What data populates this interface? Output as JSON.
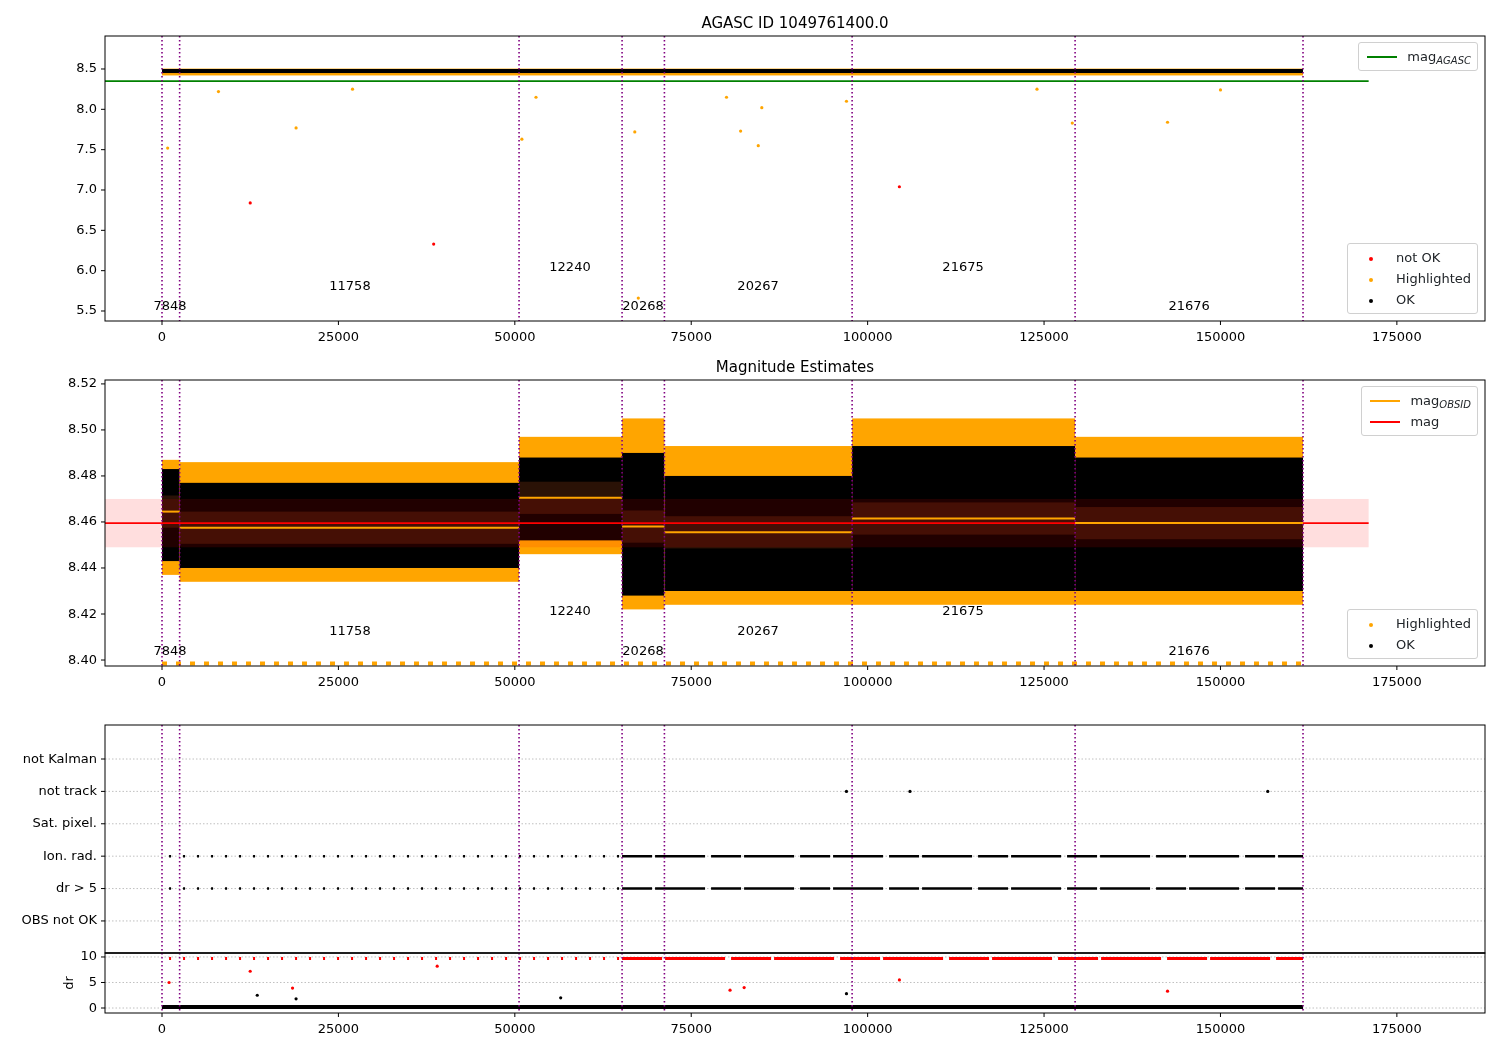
{
  "figure": {
    "panels": [
      {
        "kind": "magnitude",
        "title": "AGASC ID 1049761400.0",
        "xtick_labels": [
          "0",
          "25000",
          "50000",
          "75000",
          "100000",
          "125000",
          "150000",
          "175000"
        ],
        "ytick_labels": [
          "8.5",
          "8.0",
          "7.5",
          "7.0",
          "6.5",
          "6.0",
          "5.5"
        ],
        "obsid_labels": [
          "7848",
          "11758",
          "12240",
          "20268",
          "20267",
          "21675",
          "21676"
        ],
        "legends": [
          {
            "entries": [
              {
                "label": "mag$_{AGASC}$",
                "kind": "line",
                "color": "#008000"
              }
            ]
          },
          {
            "entries": [
              {
                "label": "not OK",
                "kind": "dot",
                "color": "#ff0000"
              },
              {
                "label": "Highlighted",
                "kind": "dot",
                "color": "#ffa500"
              },
              {
                "label": "OK",
                "kind": "dot",
                "color": "#000000"
              }
            ]
          }
        ]
      },
      {
        "kind": "estimates",
        "title": "Magnitude Estimates",
        "xtick_labels": [
          "0",
          "25000",
          "50000",
          "75000",
          "100000",
          "125000",
          "150000",
          "175000"
        ],
        "ytick_labels": [
          "8.52",
          "8.50",
          "8.48",
          "8.46",
          "8.44",
          "8.42",
          "8.40"
        ],
        "obsid_labels": [
          "7848",
          "11758",
          "12240",
          "20268",
          "20267",
          "21675",
          "21676"
        ],
        "legends": [
          {
            "entries": [
              {
                "label": "mag$_{OBSID}$",
                "kind": "line",
                "color": "#ffa500"
              },
              {
                "label": "mag",
                "kind": "line",
                "color": "#ff0000"
              }
            ]
          },
          {
            "entries": [
              {
                "label": "Highlighted",
                "kind": "dot",
                "color": "#ffa500"
              },
              {
                "label": "OK",
                "kind": "dot",
                "color": "#000000"
              }
            ]
          }
        ]
      },
      {
        "kind": "flags",
        "ytick_labels": [
          "not Kalman",
          "not track",
          "Sat. pixel.",
          "Ion. rad.",
          "dr > 5",
          "OBS not OK"
        ]
      },
      {
        "kind": "dr",
        "ylabel": "dr",
        "xtick_labels": [
          "0",
          "25000",
          "50000",
          "75000",
          "100000",
          "125000",
          "150000",
          "175000"
        ],
        "ytick_labels": [
          "10",
          "5",
          "0"
        ]
      }
    ]
  }
}
